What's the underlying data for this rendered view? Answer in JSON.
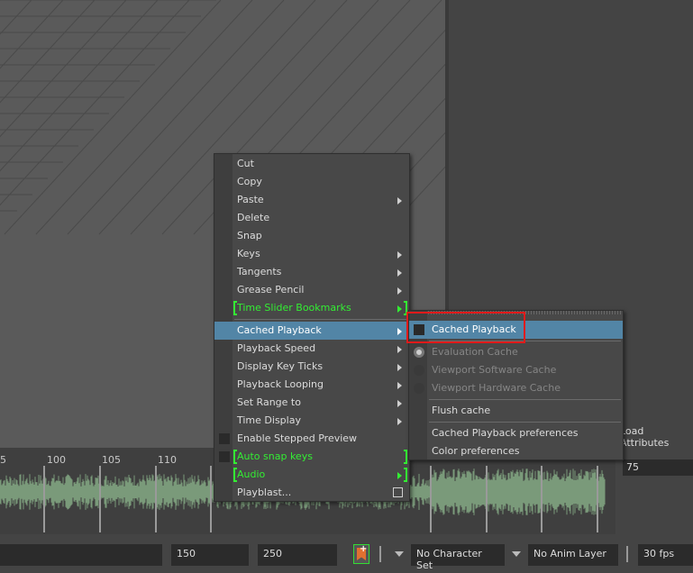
{
  "timeline": {
    "tick_labels": [
      "5",
      "100",
      "105",
      "110"
    ],
    "attr_value": "75",
    "load_attributes_label": "Load Attributes"
  },
  "range": {
    "start_value": "150",
    "end_value": "250"
  },
  "bottom": {
    "character_set": "No Character Set",
    "anim_layer": "No Anim Layer",
    "fps": "30 fps"
  },
  "context_menu": {
    "items": [
      {
        "label": "Cut"
      },
      {
        "label": "Copy"
      },
      {
        "label": "Paste",
        "submenu": true
      },
      {
        "label": "Delete"
      },
      {
        "label": "Snap"
      },
      {
        "label": "Keys",
        "submenu": true
      },
      {
        "label": "Tangents",
        "submenu": true
      },
      {
        "label": "Grease Pencil",
        "submenu": true
      },
      {
        "label": "Time Slider Bookmarks",
        "submenu": true
      },
      {
        "label": "Cached Playback",
        "submenu": true
      },
      {
        "label": "Playback Speed",
        "submenu": true
      },
      {
        "label": "Display Key Ticks",
        "submenu": true
      },
      {
        "label": "Playback Looping",
        "submenu": true
      },
      {
        "label": "Set Range to",
        "submenu": true
      },
      {
        "label": "Time Display",
        "submenu": true
      },
      {
        "label": "Enable Stepped Preview"
      },
      {
        "label": "Auto snap keys"
      },
      {
        "label": "Audio",
        "submenu": true
      },
      {
        "label": "Playblast..."
      }
    ]
  },
  "submenu": {
    "items": [
      {
        "label": "Cached Playback"
      },
      {
        "label": "Evaluation Cache"
      },
      {
        "label": "Viewport Software Cache"
      },
      {
        "label": "Viewport Hardware Cache"
      },
      {
        "label": "Flush cache"
      },
      {
        "label": "Cached Playback preferences"
      },
      {
        "label": "Color preferences"
      }
    ]
  },
  "colors": {
    "accent": "#5285a6",
    "highlight_box": "#e01a1a",
    "green_bracket": "#33ee33"
  }
}
